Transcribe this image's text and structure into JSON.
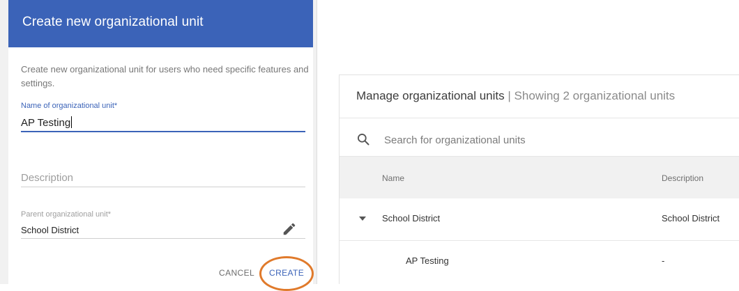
{
  "dialog": {
    "title": "Create new organizational unit",
    "intro": "Create new organizational unit for users who need specific features and settings.",
    "name_field": {
      "label": "Name of organizational unit*",
      "value": "AP Testing"
    },
    "description_field": {
      "placeholder": "Description"
    },
    "parent_field": {
      "label": "Parent organizational unit*",
      "value": "School District",
      "edit_icon": "pencil-icon"
    },
    "actions": {
      "cancel_label": "CANCEL",
      "create_label": "CREATE"
    },
    "colors": {
      "header": "#3b63b8",
      "highlight": "#e07a2b"
    }
  },
  "manage": {
    "title": "Manage organizational units",
    "separator": "|",
    "subtitle": "Showing 2 organizational units",
    "search": {
      "placeholder": "Search for organizational units",
      "icon": "search-icon"
    },
    "columns": {
      "name": "Name",
      "description": "Description"
    },
    "rows": [
      {
        "name": "School District",
        "description": "School District",
        "expand_icon": "caret-down-icon"
      },
      {
        "name": "AP Testing",
        "description": "-"
      }
    ]
  }
}
